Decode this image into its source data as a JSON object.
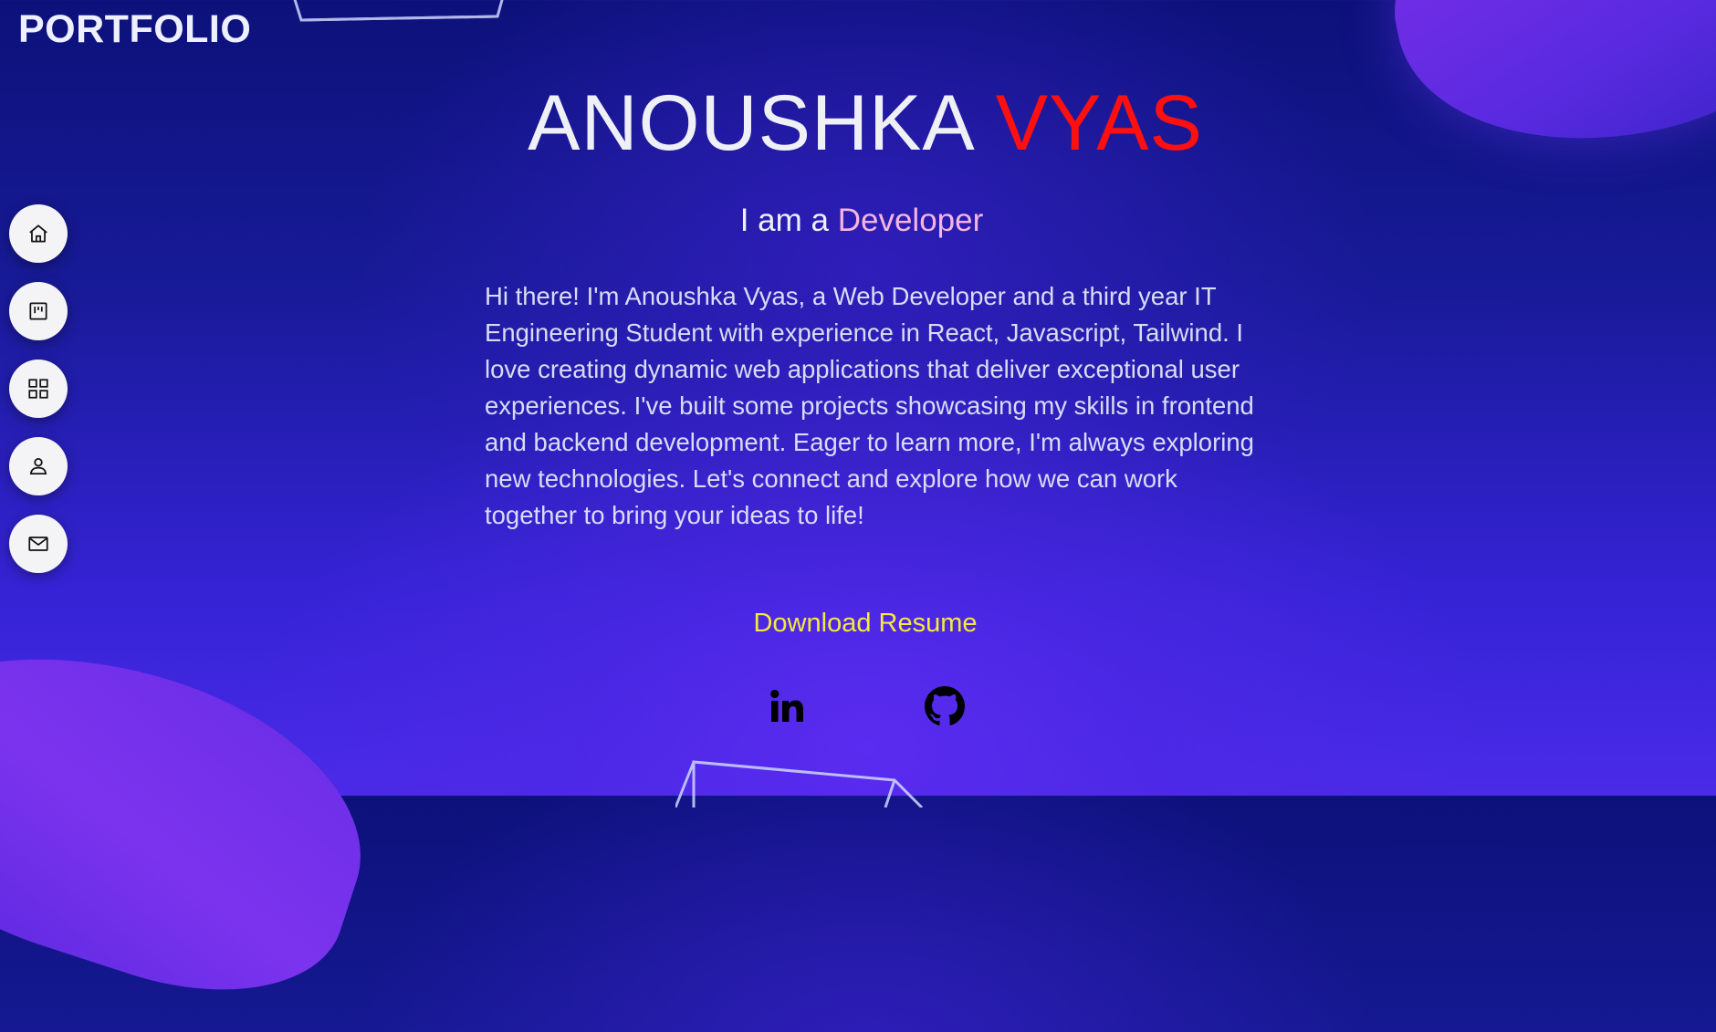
{
  "header": {
    "logo_text": "PORTFOLIO"
  },
  "sidebar": {
    "items": [
      {
        "label": "Home",
        "icon": "home-icon"
      },
      {
        "label": "Projects",
        "icon": "kanban-icon"
      },
      {
        "label": "Skills",
        "icon": "grid-icon"
      },
      {
        "label": "About",
        "icon": "person-icon"
      },
      {
        "label": "Contact",
        "icon": "mail-icon"
      }
    ]
  },
  "hero": {
    "first_name": "ANOUSHKA",
    "last_name": "VYAS",
    "role_prefix": "I am a",
    "role_highlight": "Developer",
    "bio": "Hi there! I'm Anoushka Vyas, a Web Developer and a third year IT Engineering Student with experience in React, Javascript, Tailwind. I love creating dynamic web applications that deliver exceptional user experiences. I've built some projects showcasing my skills in frontend and backend development. Eager to learn more, I'm always exploring new technologies. Let's connect and explore how we can work together to bring your ideas to life!",
    "resume_label": "Download Resume"
  },
  "social": [
    {
      "icon": "linkedin-icon"
    },
    {
      "icon": "github-icon"
    }
  ],
  "colors": {
    "accent_name": "#ff1010",
    "role_highlight": "#f4b6e0",
    "resume_link": "#f6e93a",
    "background_top": "#0c117a",
    "background_bottom": "#4a2be8"
  }
}
